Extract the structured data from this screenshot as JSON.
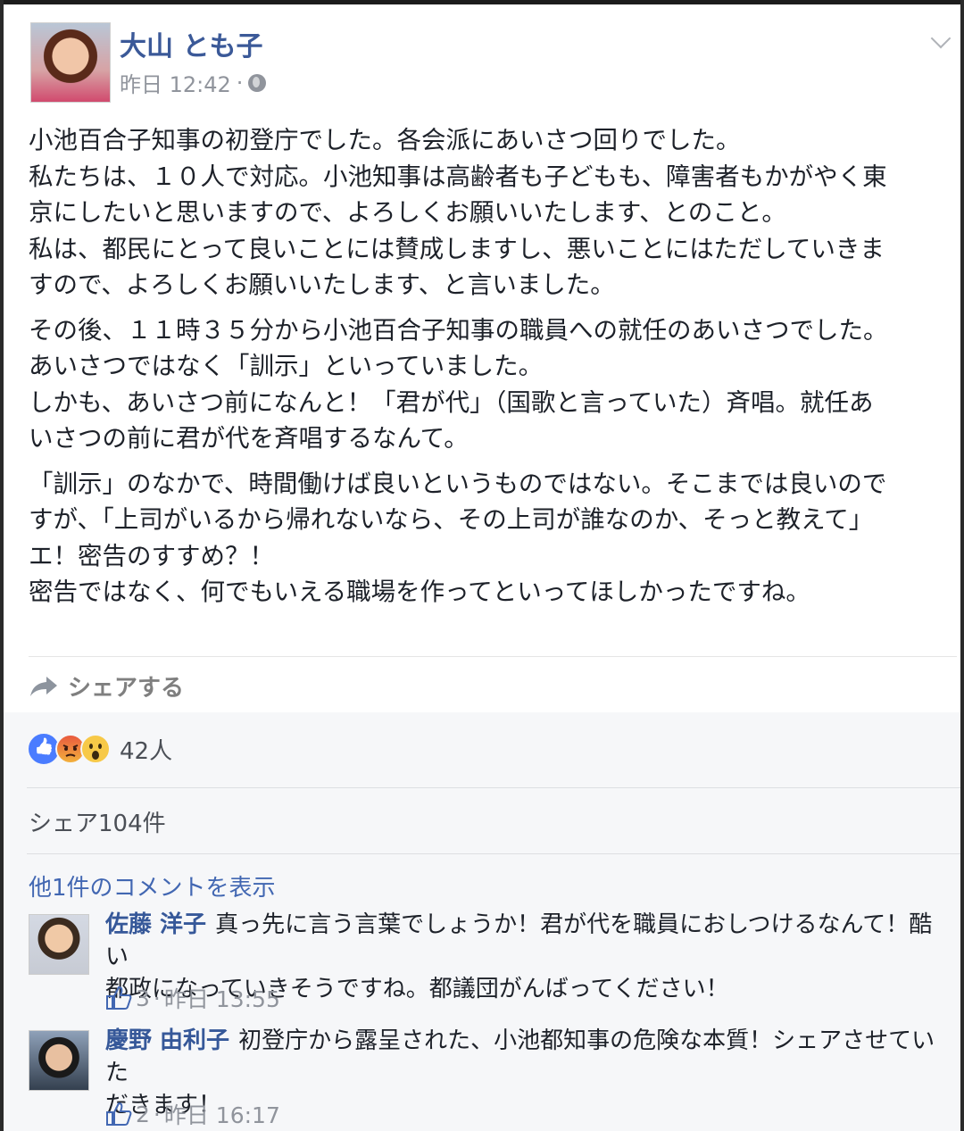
{
  "post": {
    "author": "大山 とも子",
    "timestamp": "昨日 12:42",
    "meta_sep": "·",
    "paragraphs": [
      [
        "小池百合子知事の初登庁でした。各会派にあいさつ回りでした。",
        "私たちは、１０人で対応。小池知事は高齢者も子どもも、障害者もかがやく東",
        "京にしたいと思いますので、よろしくお願いいたします、とのこと。",
        "私は、都民にとって良いことには賛成しますし、悪いことにはただしていきま",
        "すので、よろしくお願いいたします、と言いました。"
      ],
      [
        "その後、１１時３５分から小池百合子知事の職員への就任のあいさつでした。",
        "あいさつではなく「訓示」といっていました。",
        "しかも、あいさつ前になんと！「君が代」（国歌と言っていた）斉唱。就任あ",
        "いさつの前に君が代を斉唱するなんて。"
      ],
      [
        "「訓示」のなかで、時間働けば良いというものではない。そこまでは良いので",
        "すが、「上司がいるから帰れないなら、その上司が誰なのか、そっと教えて」",
        "エ！密告のすすめ？！",
        "密告ではなく、何でもいえる職場を作ってといってほしかったですね。"
      ]
    ],
    "share_label": "シェアする"
  },
  "feedback": {
    "reaction_count": "42人",
    "reactions": [
      "like-icon",
      "angry-icon",
      "wow-icon"
    ],
    "share_count": "シェア104件",
    "more_comments": "他1件のコメントを表示"
  },
  "comments": [
    {
      "name": "佐藤 洋子",
      "lines": [
        "真っ先に言う言葉でしょうか！君が代を職員におしつけるなんて！酷い",
        "都政になっていきそうですね。都議団がんばってください！"
      ],
      "likes": "3",
      "time": "昨日 13:55"
    },
    {
      "name": "慶野 由利子",
      "lines": [
        "初登庁から露呈された、小池都知事の危険な本質！シェアさせていた",
        "だきます！"
      ],
      "likes": "2",
      "time": "昨日 16:17"
    }
  ],
  "colors": {
    "link": "#365899",
    "meta": "#90949c",
    "accent": "#4267b2"
  }
}
